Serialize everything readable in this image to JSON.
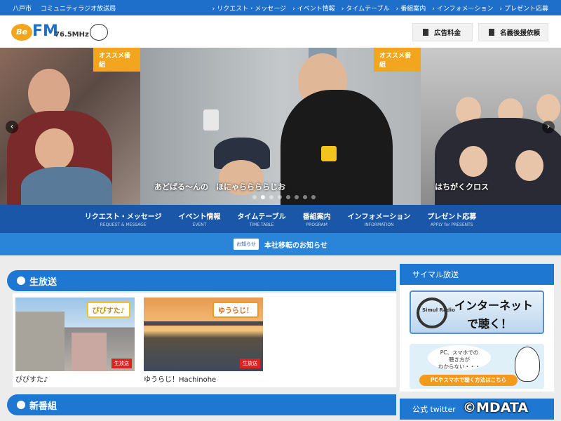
{
  "topbar": {
    "city": "八戸市",
    "station": "コミュニティラジオ放送局",
    "links": [
      "リクエスト・メッセージ",
      "イベント情報",
      "タイムテーブル",
      "番組案内",
      "インフォメーション",
      "プレゼント応募"
    ]
  },
  "header": {
    "logo": {
      "be": "Be",
      "fm": "FM",
      "freq": "76.5MHz"
    },
    "ad_button": "広告料金",
    "sponsor_button": "名義後援依頼"
  },
  "carousel": {
    "badge": "オススメ番組",
    "slides": [
      {
        "caption": ""
      },
      {
        "caption": "あどばる～んの　ほにゃららららじお"
      },
      {
        "caption": "はちがくクロス"
      }
    ],
    "dot_count": 8,
    "active_dot": 1,
    "prev": "‹",
    "next": "›"
  },
  "mainnav": [
    {
      "jp": "リクエスト・メッセージ",
      "en": "REQUEST & MESSAGE"
    },
    {
      "jp": "イベント情報",
      "en": "EVENT"
    },
    {
      "jp": "タイムテーブル",
      "en": "TIME TABLE"
    },
    {
      "jp": "番組案内",
      "en": "PROGRAM"
    },
    {
      "jp": "インフォメーション",
      "en": "INFORMATION"
    },
    {
      "jp": "プレゼント応募",
      "en": "APPLY for PRESENTS"
    }
  ],
  "notice": {
    "tag": "お知らせ",
    "text": "本社移転のお知らせ"
  },
  "live": {
    "heading": "生放送",
    "cards": [
      {
        "title": "ぴぴすた♪",
        "label": "ぴぴすた♪",
        "live_tag": "生放送"
      },
      {
        "title": "ゆうらじ！Hachinohe",
        "label": "ゆうらじ！",
        "live_tag": "生放送"
      }
    ]
  },
  "new_programs": {
    "heading": "新番組"
  },
  "sidebar": {
    "simul_heading": "サイマル放送",
    "banner1": {
      "line1": "インターネット",
      "line2": "で聴く！",
      "brand": "Simul Radio"
    },
    "banner2": {
      "bubble": "PC、スマホでの\n聴き方が\nわからない・・・",
      "cta": "PCやスマホで聴く方法はこちら"
    },
    "twitter_heading": "公式 twitter"
  },
  "watermark": "©MDATA"
}
